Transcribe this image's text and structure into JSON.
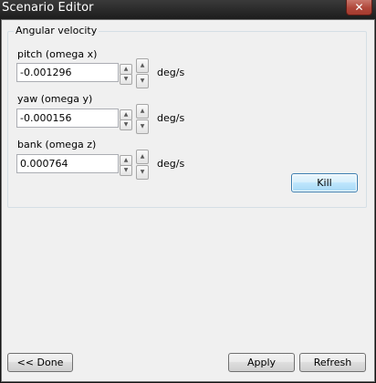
{
  "window": {
    "title": "Scenario Editor",
    "close_glyph": "✕"
  },
  "group": {
    "title": "Angular velocity"
  },
  "fields": [
    {
      "label": "pitch (omega x)",
      "value": "-0.001296",
      "unit": "deg/s"
    },
    {
      "label": "yaw (omega y)",
      "value": "-0.000156",
      "unit": "deg/s"
    },
    {
      "label": "bank (omega z)",
      "value": "0.000764",
      "unit": "deg/s"
    }
  ],
  "buttons": {
    "kill": "Kill",
    "done": "<< Done",
    "apply": "Apply",
    "refresh": "Refresh"
  },
  "icons": {
    "up": "up-arrow-icon",
    "down": "down-arrow-icon"
  }
}
